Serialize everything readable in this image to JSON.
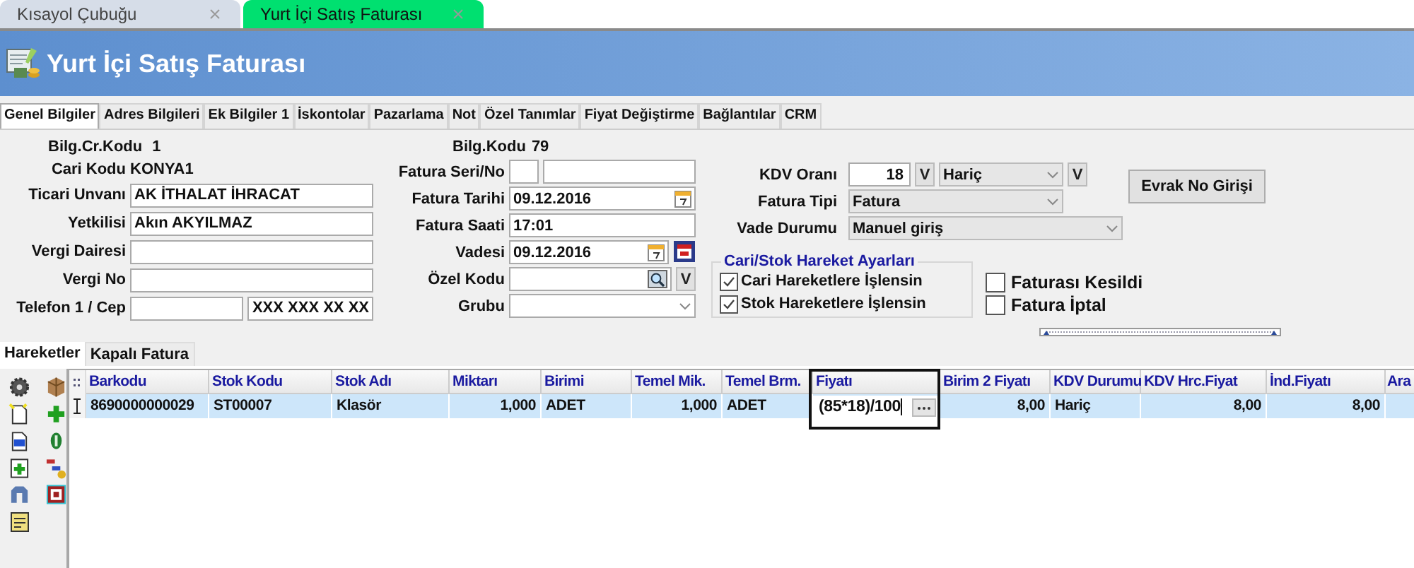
{
  "window_tabs": [
    {
      "label": "Kısayol Çubuğu",
      "selected": false
    },
    {
      "label": "Yurt İçi Satış Faturası",
      "selected": true
    }
  ],
  "header": {
    "title": "Yurt İçi Satış Faturası"
  },
  "form_tabs": [
    {
      "label": "Genel Bilgiler",
      "selected": true
    },
    {
      "label": "Adres Bilgileri",
      "selected": false
    },
    {
      "label": "Ek Bilgiler 1",
      "selected": false
    },
    {
      "label": "İskontolar",
      "selected": false
    },
    {
      "label": "Pazarlama",
      "selected": false
    },
    {
      "label": "Not",
      "selected": false
    },
    {
      "label": "Özel Tanımlar",
      "selected": false
    },
    {
      "label": "Fiyat Değiştirme",
      "selected": false
    },
    {
      "label": "Bağlantılar",
      "selected": false
    },
    {
      "label": "CRM",
      "selected": false
    }
  ],
  "left_info": [
    {
      "label": "Bilg.Cr.Kodu",
      "value": "1"
    },
    {
      "label": "Cari Kodu",
      "value": "KONYA1"
    }
  ],
  "left_fields": [
    {
      "label": "Ticari Unvanı",
      "inputs": [
        {
          "kind": "text",
          "value": "AK İTHALAT İHRACAT"
        }
      ]
    },
    {
      "label": "Yetkilisi",
      "inputs": [
        {
          "kind": "text",
          "value": "Akın AKYILMAZ"
        }
      ]
    },
    {
      "label": "Vergi Dairesi",
      "inputs": [
        {
          "kind": "text"
        }
      ]
    },
    {
      "label": "Vergi No",
      "inputs": [
        {
          "kind": "text"
        }
      ]
    },
    {
      "label": "Telefon 1 / Cep",
      "inputs": [
        {
          "kind": "text"
        },
        {
          "kind": "text",
          "value": "XXX XXX XX XX"
        }
      ]
    }
  ],
  "middle_info": {
    "label": "Bilg.Kodu",
    "value": "79"
  },
  "middle_fields": [
    {
      "label": "Fatura Seri/No",
      "inputs": [
        {
          "kind": "short"
        },
        {
          "kind": "text"
        }
      ]
    },
    {
      "label": "Fatura Tarihi",
      "inputs": [
        {
          "kind": "date",
          "value": "09.12.2016"
        }
      ]
    },
    {
      "label": "Fatura Saati",
      "inputs": [
        {
          "kind": "text",
          "value": "17:01"
        }
      ]
    },
    {
      "label": "Vadesi",
      "inputs": [
        {
          "kind": "date",
          "value": "09.12.2016"
        },
        {
          "kind": "calendar"
        }
      ]
    },
    {
      "label": "Özel Kodu",
      "inputs": [
        {
          "kind": "lookup"
        },
        {
          "kind": "button",
          "label": "V"
        }
      ]
    },
    {
      "label": "Grubu",
      "inputs": [
        {
          "kind": "dropdown"
        }
      ]
    }
  ],
  "right_fields": [
    {
      "label": "KDV Oranı",
      "inputs": [
        {
          "kind": "number",
          "value": "18"
        },
        {
          "kind": "button",
          "label": "V"
        },
        {
          "kind": "combo",
          "value": "Hariç"
        },
        {
          "kind": "button",
          "label": "V"
        }
      ]
    },
    {
      "label": "Fatura Tipi",
      "inputs": [
        {
          "kind": "select",
          "value": "Fatura"
        }
      ]
    },
    {
      "label": "Vade Durumu",
      "inputs": [
        {
          "kind": "wideselect",
          "value": "Manuel giriş"
        }
      ]
    }
  ],
  "evrak_button": {
    "label": "Evrak No Girişi"
  },
  "settings_group": {
    "title": "Cari/Stok Hareket Ayarları",
    "options": [
      {
        "label": "Cari Hareketlere İşlensin",
        "checked": true
      },
      {
        "label": "Stok Hareketlere İşlensin",
        "checked": true
      }
    ]
  },
  "flags": [
    {
      "label": "Faturası Kesildi",
      "checked": false
    },
    {
      "label": "Fatura İptal",
      "checked": false
    }
  ],
  "detail_tabs": [
    {
      "label": "Hareketler",
      "selected": true
    },
    {
      "label": "Kapalı Fatura",
      "selected": false
    }
  ],
  "table": {
    "columns": [
      {
        "label": "Barkodu",
        "kind": "text",
        "highlighted": false
      },
      {
        "label": "Stok Kodu",
        "kind": "text",
        "highlighted": false
      },
      {
        "label": "Stok Adı",
        "kind": "text",
        "highlighted": false
      },
      {
        "label": "Miktarı",
        "kind": "number",
        "highlighted": false
      },
      {
        "label": "Birimi",
        "kind": "text",
        "highlighted": false
      },
      {
        "label": "Temel Mik.",
        "kind": "number",
        "highlighted": false
      },
      {
        "label": "Temel Brm.",
        "kind": "text",
        "highlighted": false
      },
      {
        "label": "Fiyatı",
        "kind": "number",
        "highlighted": true
      },
      {
        "label": "Birim 2 Fiyatı",
        "kind": "number",
        "highlighted": false
      },
      {
        "label": "KDV Durumu",
        "kind": "text",
        "highlighted": false
      },
      {
        "label": "KDV Hrc.Fiyat",
        "kind": "number",
        "highlighted": false
      },
      {
        "label": "İnd.Fiyatı",
        "kind": "number",
        "highlighted": false
      },
      {
        "label": "Ara",
        "highlighted": false
      }
    ],
    "rows": [
      {
        "selected": true,
        "cells": [
          {
            "value": "8690000000029",
            "editing": false
          },
          {
            "value": "ST00007",
            "editing": false
          },
          {
            "value": "Klasör",
            "editing": false
          },
          {
            "value": "1,000",
            "editing": false
          },
          {
            "value": "ADET",
            "editing": false
          },
          {
            "value": "1,000",
            "editing": false
          },
          {
            "value": "ADET",
            "editing": false
          },
          {
            "value": "(85*18)/100",
            "editing": true
          },
          {
            "value": "8,00",
            "editing": false
          },
          {
            "value": "Hariç",
            "editing": false
          },
          {
            "value": "8,00",
            "editing": false
          },
          {
            "value": "8,00",
            "editing": false
          }
        ]
      }
    ]
  }
}
